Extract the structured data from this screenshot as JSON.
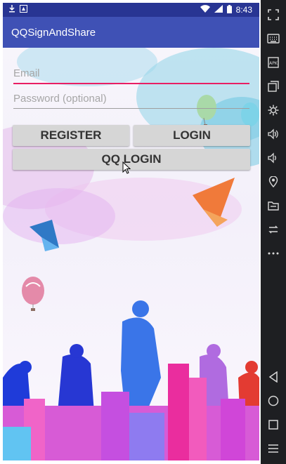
{
  "status_bar": {
    "time": "8:43",
    "icons": [
      "download-icon",
      "notification-icon",
      "wifi-icon",
      "signal-icon",
      "battery-icon"
    ]
  },
  "app_bar": {
    "title": "QQSignAndShare"
  },
  "form": {
    "email_placeholder": "Email",
    "password_placeholder": "Password (optional)"
  },
  "buttons": {
    "register": "REGISTER",
    "login": "LOGIN",
    "qq_login": "QQ LOGIN"
  },
  "colors": {
    "primary": "#3f51b5",
    "primary_dark": "#283593",
    "accent": "#e91e63",
    "button": "#d6d6d6"
  },
  "emulator_toolbar": {
    "items": [
      "fullscreen-icon",
      "keyboard-icon",
      "apk-icon",
      "window-icon",
      "settings-icon",
      "volume-up-icon",
      "volume-down-icon",
      "location-icon",
      "folder-icon",
      "rotate-icon",
      "more-icon",
      "back-icon",
      "home-icon",
      "recents-icon",
      "menu-icon"
    ]
  }
}
